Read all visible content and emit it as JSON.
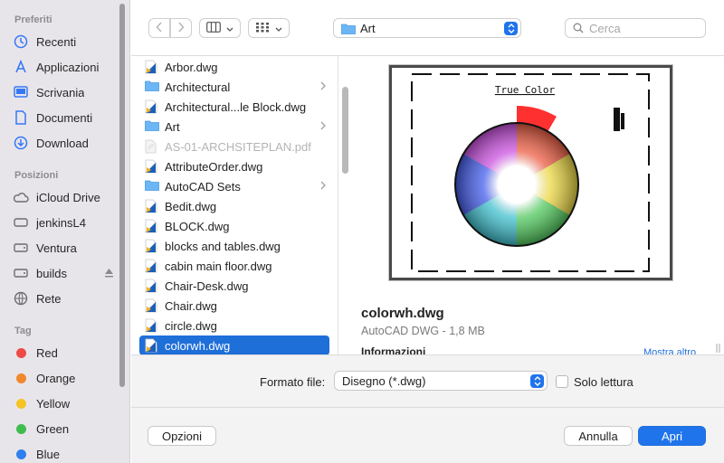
{
  "sidebar": {
    "sections": {
      "favorites": "Preferiti",
      "locations": "Posizioni",
      "tags": "Tag"
    },
    "favorites": [
      {
        "label": "Recenti",
        "icon": "clock-icon"
      },
      {
        "label": "Applicazioni",
        "icon": "applications-icon"
      },
      {
        "label": "Scrivania",
        "icon": "desktop-icon"
      },
      {
        "label": "Documenti",
        "icon": "document-icon"
      },
      {
        "label": "Download",
        "icon": "download-icon"
      }
    ],
    "locations": [
      {
        "label": "iCloud Drive",
        "icon": "cloud-icon"
      },
      {
        "label": "jenkinsL4",
        "icon": "computer-icon"
      },
      {
        "label": "Ventura",
        "icon": "disk-icon"
      },
      {
        "label": "builds",
        "icon": "disk-icon"
      },
      {
        "label": "Rete",
        "icon": "network-icon"
      }
    ],
    "tags": [
      {
        "label": "Red",
        "color": "#ee4a45"
      },
      {
        "label": "Orange",
        "color": "#f0882d"
      },
      {
        "label": "Yellow",
        "color": "#f5c423"
      },
      {
        "label": "Green",
        "color": "#3fbd4e"
      },
      {
        "label": "Blue",
        "color": "#2f80ed"
      }
    ]
  },
  "toolbar": {
    "back_icon": "chevron-left-icon",
    "forward_icon": "chevron-right-icon",
    "view_icon": "columns-view-icon",
    "group_icon": "grid-view-icon",
    "path": "Art",
    "search_placeholder": "Cerca"
  },
  "files": [
    {
      "name": "Arbor.dwg",
      "type": "dwg"
    },
    {
      "name": "Architectural",
      "type": "folder"
    },
    {
      "name": "Architectural...le Block.dwg",
      "type": "dwg"
    },
    {
      "name": "Art",
      "type": "folder"
    },
    {
      "name": "AS-01-ARCHSITEPLAN.pdf",
      "type": "pdf",
      "disabled": true
    },
    {
      "name": "AttributeOrder.dwg",
      "type": "dwg"
    },
    {
      "name": "AutoCAD Sets",
      "type": "folder"
    },
    {
      "name": "Bedit.dwg",
      "type": "dwg"
    },
    {
      "name": "BLOCK.dwg",
      "type": "dwg"
    },
    {
      "name": "blocks and tables.dwg",
      "type": "dwg"
    },
    {
      "name": "cabin main floor.dwg",
      "type": "dwg"
    },
    {
      "name": "Chair-Desk.dwg",
      "type": "dwg"
    },
    {
      "name": "Chair.dwg",
      "type": "dwg"
    },
    {
      "name": "circle.dwg",
      "type": "dwg"
    },
    {
      "name": "colorwh.dwg",
      "type": "dwg",
      "selected": true
    }
  ],
  "preview": {
    "drawing_title": "True Color",
    "name": "colorwh.dwg",
    "subtitle": "AutoCAD DWG - 1,8 MB",
    "info_label": "Informazioni",
    "more_link": "Mostra altro"
  },
  "bottom": {
    "format_label": "Formato file:",
    "format_value": "Disegno (*.dwg)",
    "readonly_label": "Solo lettura",
    "options_button": "Opzioni",
    "cancel_button": "Annulla",
    "open_button": "Apri"
  }
}
